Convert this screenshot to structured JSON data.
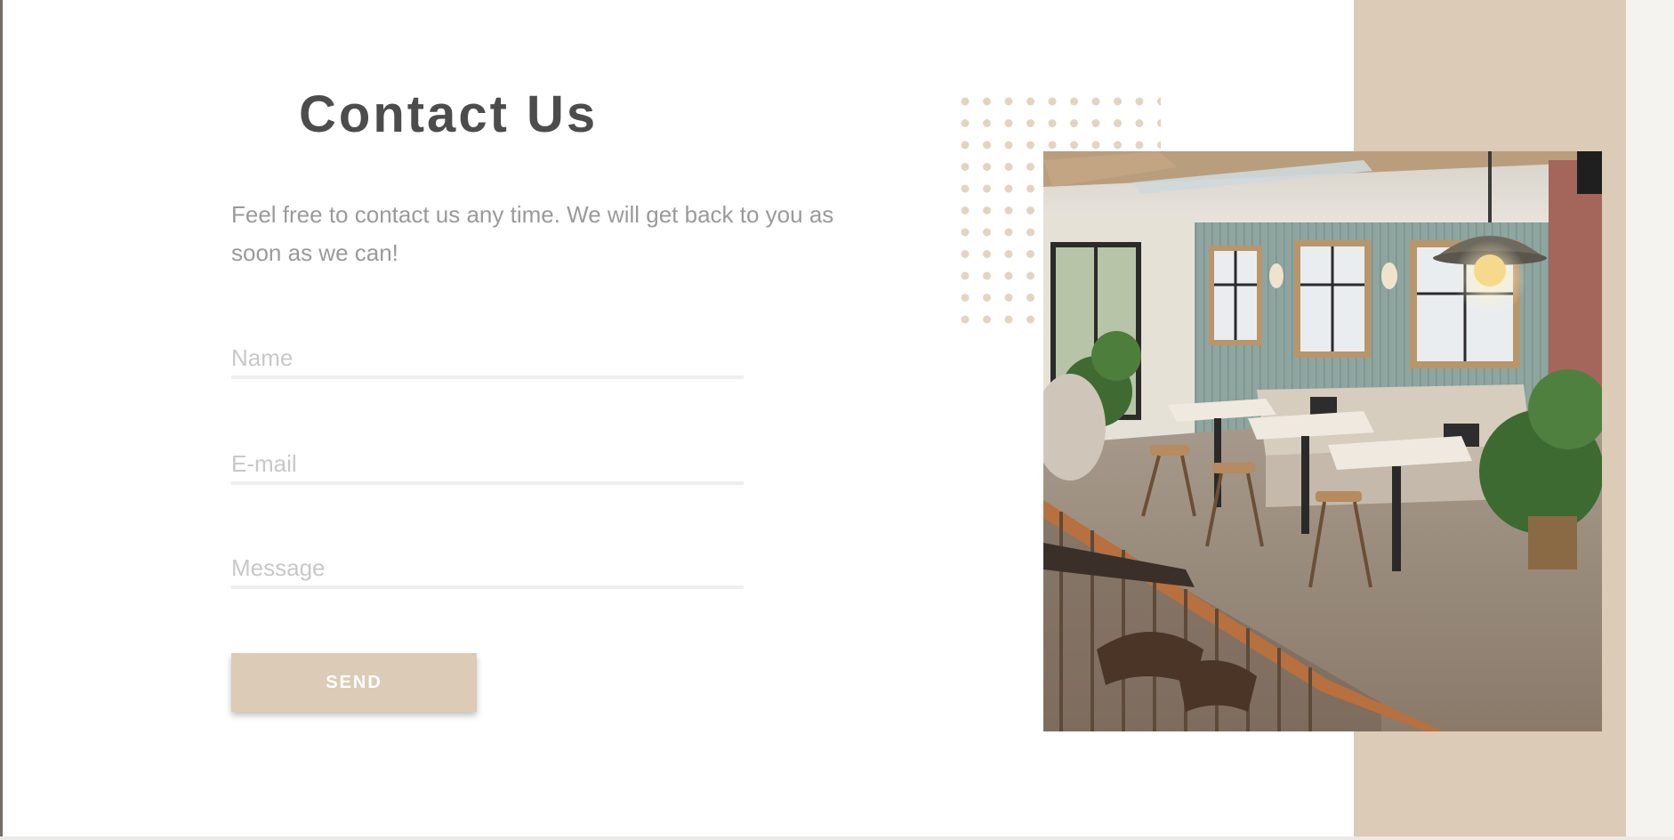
{
  "contact": {
    "title": "Contact Us",
    "intro": "Feel free to contact us any time. We will get back to you as soon as we can!"
  },
  "form": {
    "name_placeholder": "Name",
    "email_placeholder": "E-mail",
    "message_placeholder": "Message",
    "send_label": "SEND"
  },
  "colors": {
    "accent": "#dccbb6",
    "title": "#4c4c4c",
    "body_text": "#9a9a9a",
    "placeholder": "#c8c8c8"
  },
  "decor": {
    "dot_pattern_icon": "dot-grid-icon",
    "photo_subject": "restaurant-interior-photo"
  }
}
